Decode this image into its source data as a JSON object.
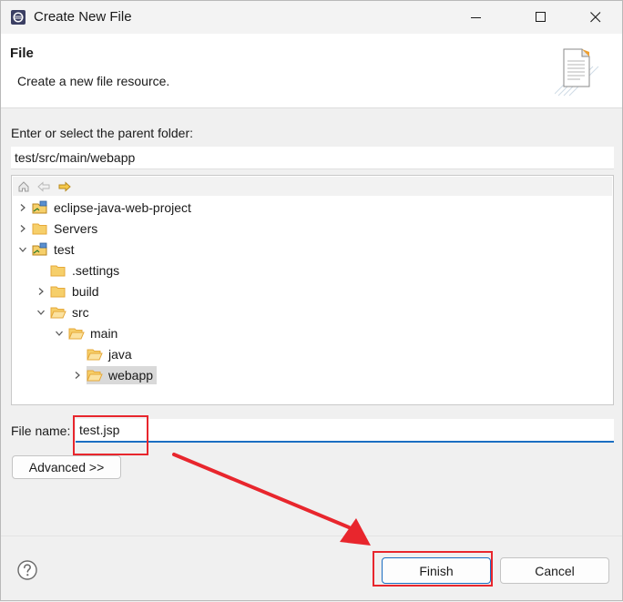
{
  "window": {
    "title": "Create New File"
  },
  "header": {
    "title": "File",
    "description": "Create a new file resource."
  },
  "parent_folder": {
    "label": "Enter or select the parent folder:",
    "value": "test/src/main/webapp"
  },
  "tree": {
    "items": [
      {
        "label": "eclipse-java-web-project",
        "type": "project",
        "expander": "collapsed"
      },
      {
        "label": "Servers",
        "type": "folder",
        "expander": "collapsed"
      },
      {
        "label": "test",
        "type": "project",
        "expander": "expanded"
      },
      {
        "label": ".settings",
        "type": "folder",
        "expander": "none"
      },
      {
        "label": "build",
        "type": "folder",
        "expander": "collapsed"
      },
      {
        "label": "src",
        "type": "folder-open",
        "expander": "expanded"
      },
      {
        "label": "main",
        "type": "folder-open",
        "expander": "expanded"
      },
      {
        "label": "java",
        "type": "folder-open",
        "expander": "none"
      },
      {
        "label": "webapp",
        "type": "folder-open",
        "expander": "collapsed",
        "selected": true
      }
    ]
  },
  "file_name": {
    "label": "File name:",
    "value": "test.jsp"
  },
  "buttons": {
    "advanced": "Advanced >>",
    "finish": "Finish",
    "cancel": "Cancel"
  },
  "colors": {
    "accent": "#1b6ec2",
    "annotation_red": "#e8262d",
    "folder": "#e6a93a"
  },
  "icons": {
    "app": "eclipse-icon",
    "minimize": "minimize-icon",
    "maximize": "maximize-icon",
    "close": "close-icon",
    "header_graphic": "new-file-wizard-icon",
    "home": "home-icon",
    "back": "back-arrow-icon",
    "forward": "forward-arrow-icon",
    "help": "help-icon"
  }
}
